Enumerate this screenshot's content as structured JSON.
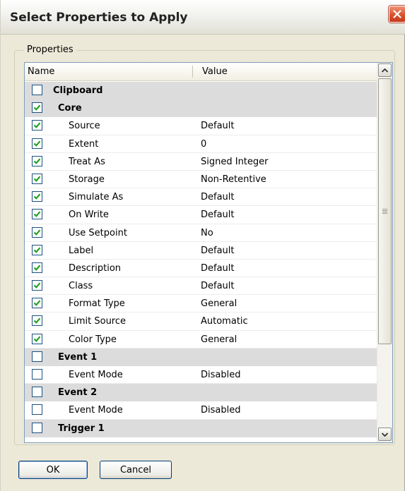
{
  "window": {
    "title": "Select Properties to Apply"
  },
  "group": {
    "legend": "Properties"
  },
  "list": {
    "columns": {
      "name": "Name",
      "value": "Value"
    },
    "rows": [
      {
        "kind": "group",
        "indent": 0,
        "label": "Clipboard",
        "value": "",
        "checked": false
      },
      {
        "kind": "group",
        "indent": 1,
        "label": "Core",
        "value": "",
        "checked": true
      },
      {
        "kind": "prop",
        "label": "Source",
        "value": "Default",
        "checked": true
      },
      {
        "kind": "prop",
        "label": "Extent",
        "value": "0",
        "checked": true
      },
      {
        "kind": "prop",
        "label": "Treat As",
        "value": "Signed Integer",
        "checked": true
      },
      {
        "kind": "prop",
        "label": "Storage",
        "value": "Non-Retentive",
        "checked": true
      },
      {
        "kind": "prop",
        "label": "Simulate As",
        "value": "Default",
        "checked": true
      },
      {
        "kind": "prop",
        "label": "On Write",
        "value": "Default",
        "checked": true
      },
      {
        "kind": "prop",
        "label": "Use Setpoint",
        "value": "No",
        "checked": true
      },
      {
        "kind": "prop",
        "label": "Label",
        "value": "Default",
        "checked": true
      },
      {
        "kind": "prop",
        "label": "Description",
        "value": "Default",
        "checked": true
      },
      {
        "kind": "prop",
        "label": "Class",
        "value": "Default",
        "checked": true
      },
      {
        "kind": "prop",
        "label": "Format Type",
        "value": "General",
        "checked": true
      },
      {
        "kind": "prop",
        "label": "Limit Source",
        "value": "Automatic",
        "checked": true
      },
      {
        "kind": "prop",
        "label": "Color Type",
        "value": "General",
        "checked": true
      },
      {
        "kind": "group",
        "indent": 1,
        "label": "Event 1",
        "value": "",
        "checked": false
      },
      {
        "kind": "prop",
        "label": "Event Mode",
        "value": "Disabled",
        "checked": false
      },
      {
        "kind": "group",
        "indent": 1,
        "label": "Event 2",
        "value": "",
        "checked": false
      },
      {
        "kind": "prop",
        "label": "Event Mode",
        "value": "Disabled",
        "checked": false
      },
      {
        "kind": "group",
        "indent": 1,
        "label": "Trigger 1",
        "value": "",
        "checked": false
      }
    ]
  },
  "buttons": {
    "ok": "OK",
    "cancel": "Cancel"
  },
  "icons": {
    "close": "close-icon",
    "scroll_up": "chevron-up-icon",
    "scroll_down": "chevron-down-icon",
    "checkmark": "checkmark-icon"
  },
  "colors": {
    "window_bg": "#ece9d8",
    "group_row_bg": "#dcdcdc",
    "check_green": "#21a121",
    "close_red": "#d9532e"
  }
}
